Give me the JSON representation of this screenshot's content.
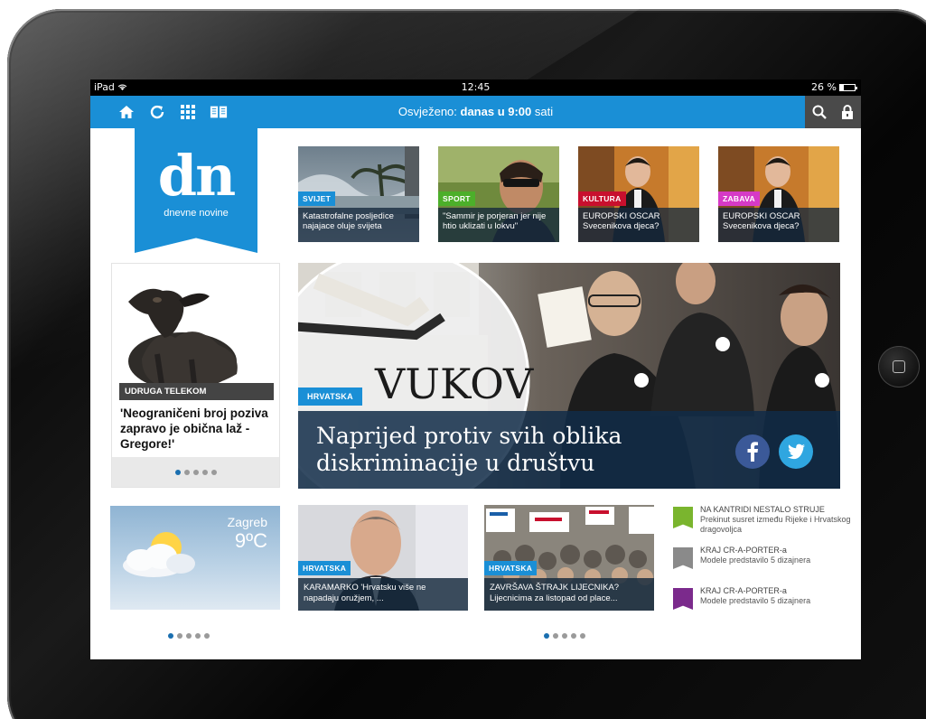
{
  "status_bar": {
    "device": "iPad",
    "time": "12:45",
    "battery": "26 %"
  },
  "toolbar": {
    "refresh_prefix": "Osvježeno: ",
    "refresh_bold": "danas u 9:00",
    "refresh_suffix": " sati",
    "icons": [
      "home-icon",
      "refresh-icon",
      "grid-icon",
      "book-icon",
      "search-icon",
      "lock-icon"
    ]
  },
  "logo": {
    "mark": "dn",
    "name": "dnevne novine",
    "color": "#1a8fd6"
  },
  "top_stories": [
    {
      "tag": "SVIJET",
      "tag_color": "#1a8fd6",
      "text": "Katastrofalne posljedice najajace oluje svijeta"
    },
    {
      "tag": "SPORT",
      "tag_color": "#4caf2a",
      "text": "\"Sammir je porjeran jer nije htio uklizati u lokvu\""
    },
    {
      "tag": "KULTURA",
      "tag_color": "#c8102e",
      "text": "EUROPSKI OSCAR Svecenikova djeca?"
    },
    {
      "tag": "ZABAVA",
      "tag_color": "#d63ac6",
      "text": "EUROPSKI OSCAR Svecenikova djeca?"
    }
  ],
  "left_story": {
    "tag": "UDRUGA TELEKOM",
    "headline": "'Neograničeni broj poziva zapravo je obična laž - Gregore!'",
    "dots": 5,
    "active_dot": 0
  },
  "hero": {
    "tag": "HRVATSKA",
    "sign_text": "VUKOV",
    "title_line1": "Naprijed protiv svih oblika",
    "title_line2": "diskriminacije u društvu",
    "facebook_color": "#3b5998",
    "twitter_color": "#2fa6e0"
  },
  "weather": {
    "city": "Zagreb",
    "temperature": "9ºC"
  },
  "bottom_stories": [
    {
      "tag": "HRVATSKA",
      "text": "KARAMARKO 'Hrvatsku više ne napadaju oružjem, ..."
    },
    {
      "tag": "HRVATSKA",
      "text": "ZAVRŠAVA ŠTRAJK LIJECNIKA? Lijecnicima za listopad od place..."
    }
  ],
  "side_list": [
    {
      "headline": "NA KANTRIDI NESTALO STRUJE",
      "text": "Prekinut susret između Rijeke i Hrvatskog dragovoljca",
      "color": "#7ab52e"
    },
    {
      "headline": "KRAJ CR-A-PORTER-a",
      "text": "Modele predstavilo 5 dizajnera",
      "color": "#8a8a8a"
    },
    {
      "headline": "KRAJ CR-A-PORTER-a",
      "text": "Modele predstavilo 5 dizajnera",
      "color": "#7b2a8c"
    }
  ],
  "pagers": {
    "weather_dots": 5,
    "news_dots": 5,
    "active": 0
  }
}
